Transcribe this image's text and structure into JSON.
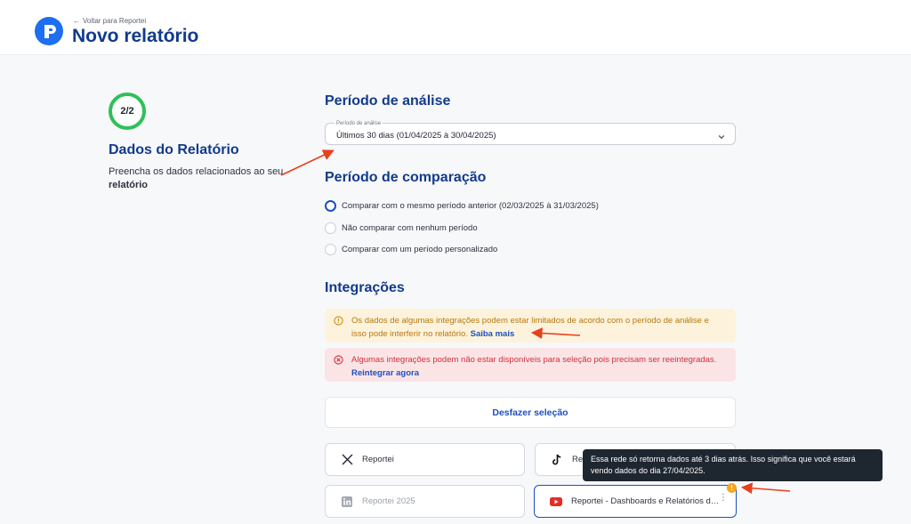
{
  "header": {
    "back_label": "Voltar para Reportei",
    "title": "Novo relatório"
  },
  "step": {
    "counter": "2/2",
    "title": "Dados do Relatório",
    "description": "Preencha os dados relacionados ao seu",
    "description_bold": "relatório"
  },
  "analysis": {
    "title": "Período de análise",
    "field_label": "Período de análise",
    "value": "Últimos 30 dias (01/04/2025 à 30/04/2025)"
  },
  "comparison": {
    "title": "Período de comparação",
    "options": [
      {
        "label": "Comparar com o mesmo período anterior (02/03/2025 à 31/03/2025)",
        "checked": true
      },
      {
        "label": "Não comparar com nenhum período",
        "checked": false
      },
      {
        "label": "Comparar com um período personalizado",
        "checked": false
      }
    ]
  },
  "integrations": {
    "title": "Integrações",
    "warning_text": "Os dados de algumas integrações podem estar limitados de acordo com o período de análise e isso pode interferir no relatório.",
    "warning_link": "Saiba mais",
    "error_text": "Algumas integrações podem não estar disponíveis para seleção pois precisam ser reeintegradas.",
    "error_link": "Reintegrar agora",
    "undo_label": "Desfazer seleção",
    "cards": [
      {
        "label": "Reportei",
        "icon": "x-twitter-icon"
      },
      {
        "label": "Re",
        "icon": "tiktok-icon"
      },
      {
        "label": "Reportei 2025",
        "icon": "linkedin-icon",
        "disabled": true
      },
      {
        "label": "Reportei - Dashboards e Relatórios de...",
        "icon": "youtube-icon",
        "selected": true
      }
    ],
    "tooltip": "Essa rede só retorna dados até 3 dias atrás. Isso significa que você estará vendo dados do dia 27/04/2025."
  },
  "colors": {
    "brand_blue": "#1d6ef1",
    "title_navy": "#123a8c",
    "step_green": "#2ec05a",
    "warning_bg": "#fdf3dc",
    "error_bg": "#fbe4e6",
    "annotation_red": "#e8401c"
  }
}
